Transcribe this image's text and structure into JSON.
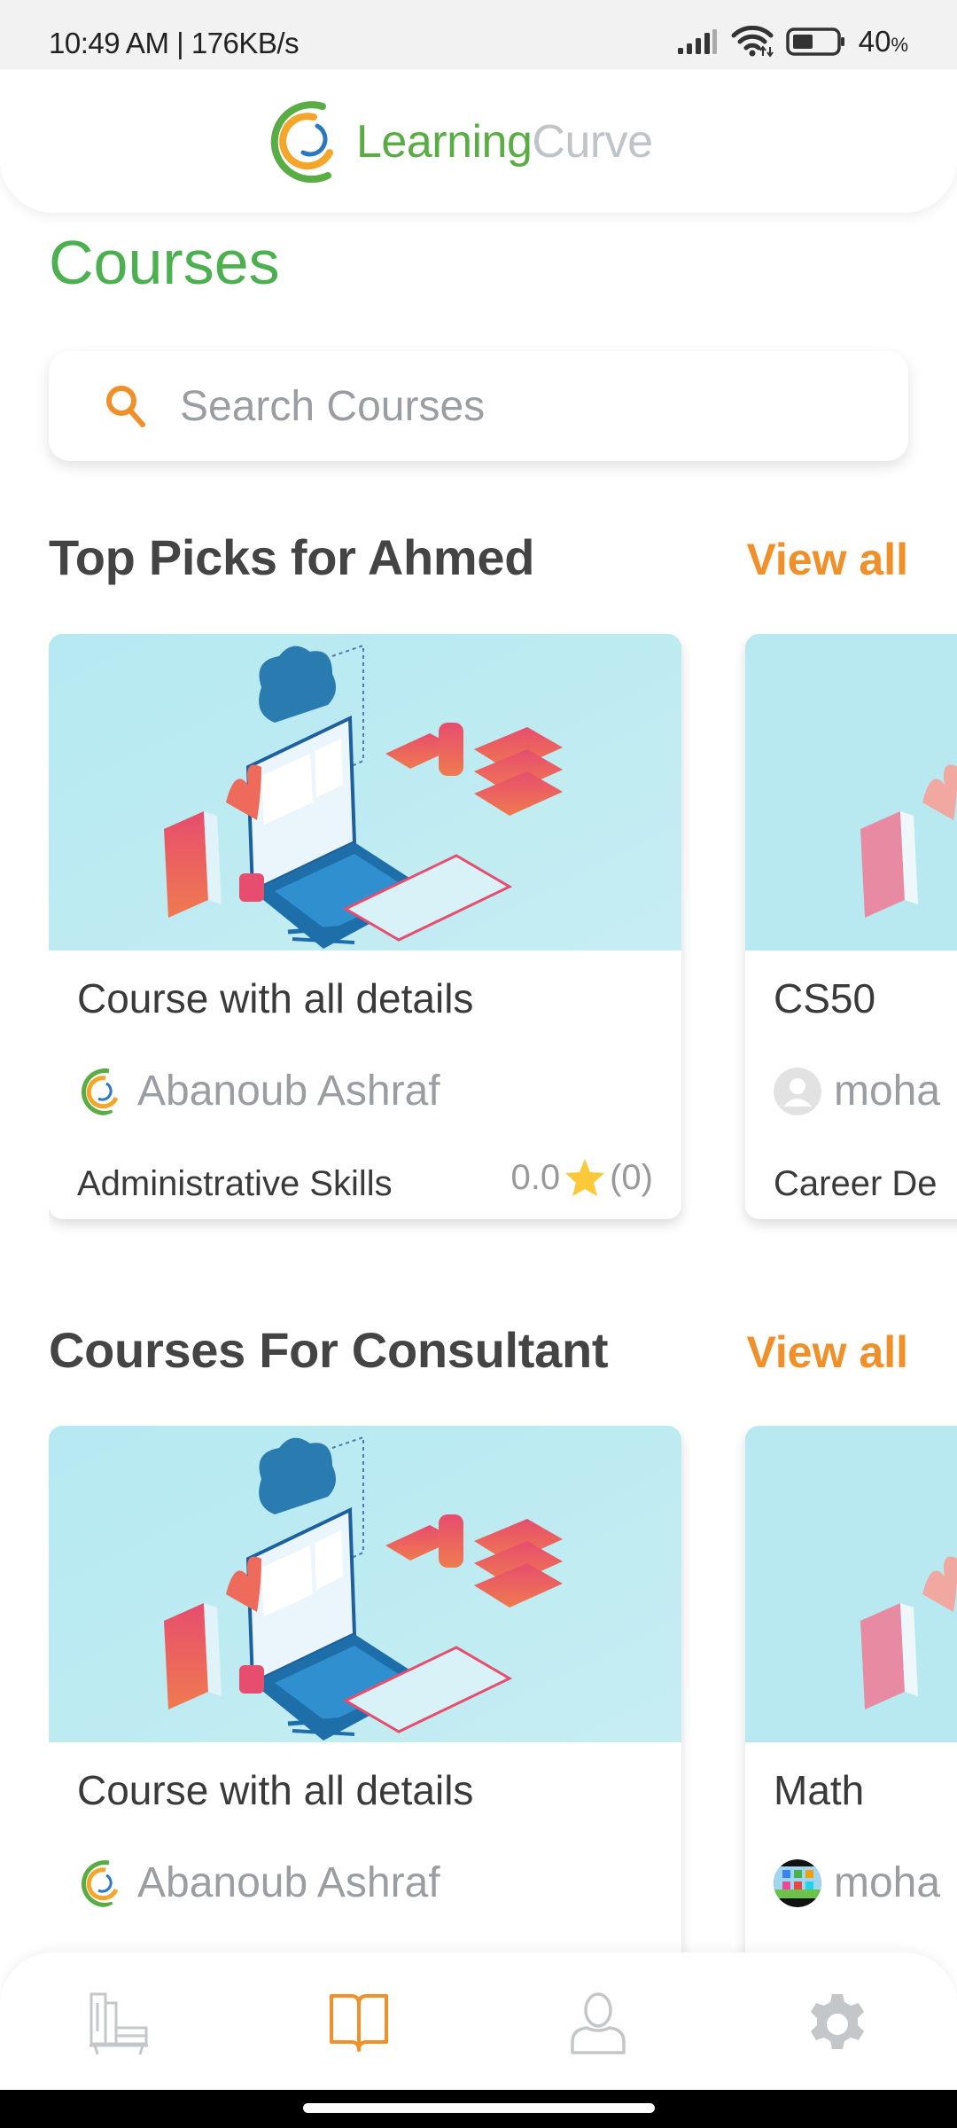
{
  "status_bar": {
    "time_speed": "10:49 AM | 176KB/s",
    "battery_percent": "40",
    "battery_percent_sign": "%",
    "icons": [
      "signal-icon",
      "wifi-icon",
      "battery-icon"
    ]
  },
  "header": {
    "logo_text_part1": "Learning",
    "logo_text_part2": "Curve"
  },
  "page": {
    "title": "Courses"
  },
  "search": {
    "placeholder": "Search Courses",
    "value": ""
  },
  "sections": [
    {
      "title": "Top Picks for Ahmed",
      "view_all": "View all",
      "courses": [
        {
          "title": "Course with all details",
          "author": "Abanoub Ashraf",
          "author_avatar": "learningcurve-logo",
          "category": "Administrative Skills",
          "rating": "0.0",
          "reviews": "(0)"
        },
        {
          "title": "CS50",
          "author": "moha",
          "author_avatar": "default-user",
          "category": "Career De"
        }
      ]
    },
    {
      "title": "Courses For Consultant",
      "view_all": "View all",
      "courses": [
        {
          "title": "Course with all details",
          "author": "Abanoub Ashraf",
          "author_avatar": "learningcurve-logo"
        },
        {
          "title": "Math",
          "author": "moha",
          "author_avatar": "apps-photo"
        }
      ]
    }
  ],
  "bottom_nav": {
    "items": [
      {
        "name": "library",
        "icon": "bookshelf-icon",
        "active": false
      },
      {
        "name": "courses",
        "icon": "open-book-icon",
        "active": true
      },
      {
        "name": "profile",
        "icon": "user-icon",
        "active": false
      },
      {
        "name": "settings",
        "icon": "gear-icon",
        "active": false
      }
    ]
  },
  "colors": {
    "brand_green": "#4caf50",
    "accent_orange": "#f0902a",
    "inactive_gray": "#c4c7ca",
    "star_yellow": "#fbc93a"
  }
}
